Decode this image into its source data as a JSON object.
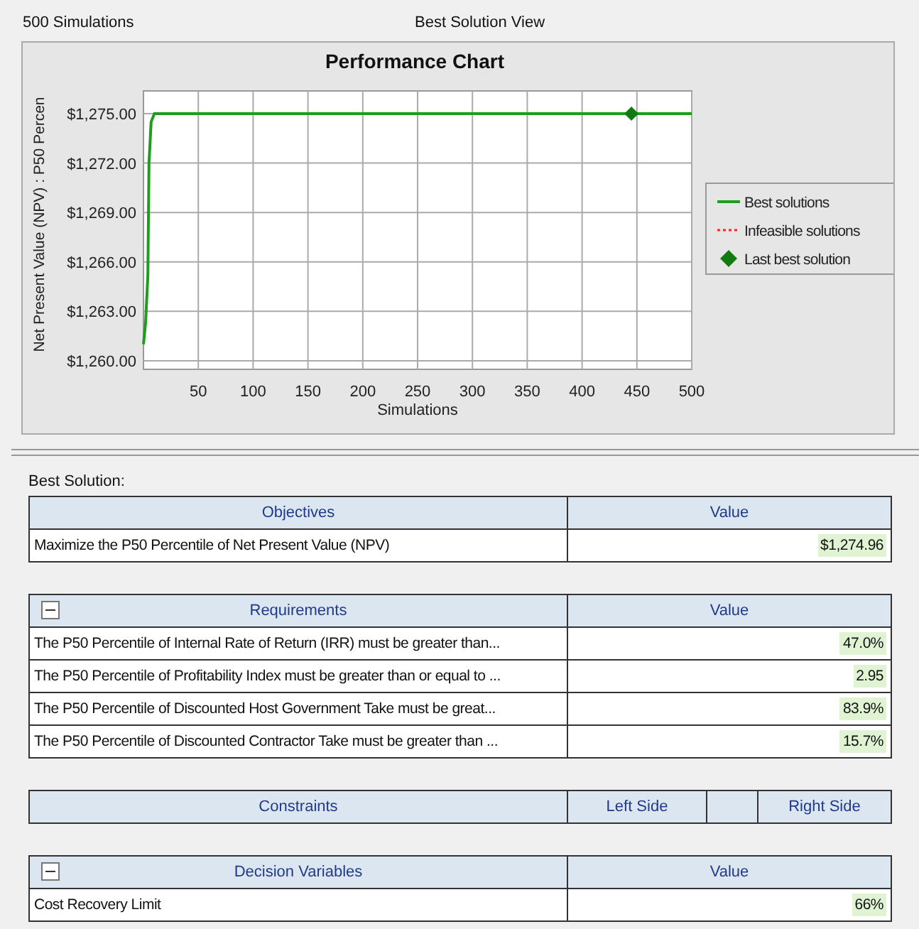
{
  "header": {
    "run_count": "500 Simulations",
    "view_title": "Best Solution View"
  },
  "chart": {
    "chart_data": {
      "type": "line",
      "title": "Performance Chart",
      "xlabel": "Simulations",
      "ylabel": "Net Present Value (NPV) : P50 Percen",
      "grid": true,
      "legend": true,
      "x": [
        0,
        2,
        4,
        5,
        7,
        10,
        445,
        500
      ],
      "series": [
        {
          "name": "Best solutions",
          "color": "#1e9e1e",
          "line_style": "solid",
          "values": [
            1261,
            1262.3,
            1265.2,
            1272,
            1274.5,
            1275,
            1275,
            1275
          ]
        },
        {
          "name": "Infeasible solutions",
          "color": "#ff2020",
          "line_style": "dotted",
          "values": [
            null,
            null,
            null,
            null,
            null,
            null,
            null,
            null
          ]
        },
        {
          "name": "Last best solution",
          "color": "#127a12",
          "line_style": "none",
          "marker": "diamond",
          "values": [
            null,
            null,
            null,
            null,
            null,
            null,
            1275,
            null
          ]
        }
      ],
      "xlim": [
        0,
        500
      ],
      "ylim": [
        1259.48,
        1276.38
      ],
      "xticks": [
        50,
        100,
        150,
        200,
        250,
        300,
        350,
        400,
        450,
        500
      ],
      "yticks": [
        {
          "value": 1260,
          "label": "$1,260.00"
        },
        {
          "value": 1263,
          "label": "$1,263.00"
        },
        {
          "value": 1266,
          "label": "$1,266.00"
        },
        {
          "value": 1269,
          "label": "$1,269.00"
        },
        {
          "value": 1272,
          "label": "$1,272.00"
        },
        {
          "value": 1275,
          "label": "$1,275.00"
        }
      ]
    }
  },
  "best_solution": {
    "label": "Best Solution:",
    "objectives": {
      "columns": [
        "Objectives",
        "Value"
      ],
      "rows": [
        {
          "name": "Maximize the P50 Percentile of Net Present Value (NPV)",
          "value": "$1,274.96"
        }
      ]
    },
    "requirements": {
      "expanded": true,
      "columns": [
        "Requirements",
        "Value"
      ],
      "rows": [
        {
          "name": "The P50 Percentile of Internal Rate of Return (IRR) must be greater than...",
          "value": "47.0%"
        },
        {
          "name": "The P50 Percentile of Profitability Index must be greater than or equal to ...",
          "value": "2.95"
        },
        {
          "name": "The P50 Percentile of Discounted Host Government Take must be great...",
          "value": "83.9%"
        },
        {
          "name": "The P50 Percentile of Discounted Contractor Take must be greater than ...",
          "value": "15.7%"
        }
      ]
    },
    "constraints": {
      "columns": [
        "Constraints",
        "Left Side",
        "Right Side"
      ]
    },
    "decision_variables": {
      "expanded": true,
      "columns": [
        "Decision Variables",
        "Value"
      ],
      "rows": [
        {
          "name": "Cost Recovery Limit",
          "value": "66%"
        }
      ]
    }
  }
}
